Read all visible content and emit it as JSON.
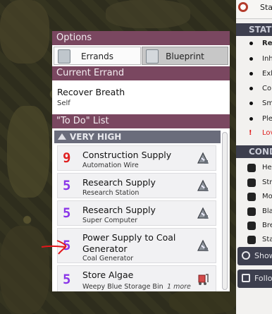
{
  "right_panel": {
    "top_label": "Sta",
    "status_header": "STATU",
    "status_items": [
      {
        "label": "Re",
        "bold": true
      },
      {
        "label": "Inh"
      },
      {
        "label": "Exh"
      },
      {
        "label": "Co"
      },
      {
        "label": "Sm"
      },
      {
        "label": "Ple"
      },
      {
        "label": "Lov",
        "warning": true
      }
    ],
    "conditions_header": "CONDI",
    "condition_items": [
      {
        "label": "He",
        "icon": "heart-icon"
      },
      {
        "label": "Str",
        "icon": "stress-icon"
      },
      {
        "label": "Mo",
        "icon": "morale-icon"
      },
      {
        "label": "Bla",
        "icon": "bladder-icon"
      },
      {
        "label": "Bre",
        "icon": "breath-icon"
      },
      {
        "label": "Sta",
        "icon": "stamina-icon"
      }
    ],
    "buttons": [
      {
        "label": "Show",
        "icon": "eye-icon"
      },
      {
        "label": "Follow",
        "icon": "follow-icon"
      }
    ]
  },
  "options": {
    "header": "Options",
    "tabs": [
      {
        "label": "Errands",
        "active": true,
        "icon": "errands-icon"
      },
      {
        "label": "Blueprint",
        "active": false,
        "icon": "blueprint-icon"
      }
    ]
  },
  "current_errand": {
    "header": "Current Errand",
    "name": "Recover Breath",
    "target": "Self"
  },
  "todo": {
    "header": "\"To Do\" List",
    "priority_label": "VERY HIGH",
    "items": [
      {
        "priority": "9",
        "color": "#e01f1f",
        "title": "Construction Supply",
        "subtitle": "Automation Wire",
        "icon": "construction-icon"
      },
      {
        "priority": "5",
        "color": "#8a35e8",
        "title": "Research Supply",
        "subtitle": "Research Station",
        "icon": "research-icon"
      },
      {
        "priority": "5",
        "color": "#8a35e8",
        "title": "Research Supply",
        "subtitle": "Super Computer",
        "icon": "research-icon"
      },
      {
        "priority": "5",
        "color": "#8a35e8",
        "title": "Power Supply to Coal Generator",
        "subtitle": "Coal Generator",
        "icon": "power-icon"
      },
      {
        "priority": "5",
        "color": "#8a35e8",
        "title": "Store Algae",
        "subtitle": "Weepy Blue Storage Bin",
        "more": "1 more",
        "icon": "storage-icon"
      }
    ]
  },
  "colors": {
    "header_bg": "#7a4760",
    "priority_bg": "#6a6c7b",
    "panel_dark": "#3d3f4e"
  }
}
